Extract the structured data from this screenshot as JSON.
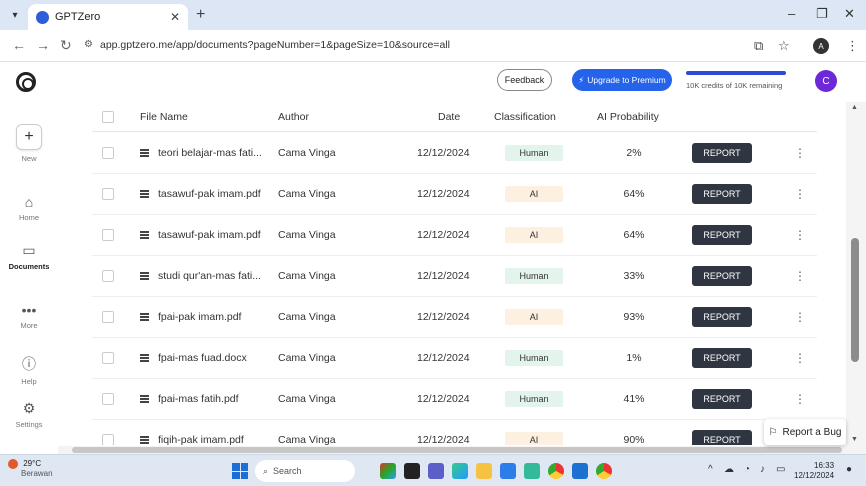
{
  "browser": {
    "tab_title": "GPTZero",
    "url": "app.gptzero.me/app/documents?pageNumber=1&pageSize=10&source=all"
  },
  "header": {
    "feedback_label": "Feedback",
    "upgrade_label": "Upgrade to Premium",
    "credits_text": "10K credits of 10K remaining",
    "credits_fraction": 1.0,
    "avatar_letter": "C"
  },
  "sidebar": {
    "items": [
      {
        "label": "New",
        "icon": "plus-icon"
      },
      {
        "label": "Home",
        "icon": "home-icon"
      },
      {
        "label": "Documents",
        "icon": "folder-icon"
      },
      {
        "label": "More",
        "icon": "more-icon"
      },
      {
        "label": "Help",
        "icon": "help-icon"
      },
      {
        "label": "Settings",
        "icon": "gear-icon"
      }
    ]
  },
  "table": {
    "columns": [
      "File Name",
      "Author",
      "Date",
      "Classification",
      "AI Probability"
    ],
    "report_label": "REPORT",
    "rows": [
      {
        "file": "teori belajar-mas fati...",
        "author": "Cama Vinga",
        "date": "12/12/2024",
        "class": "Human",
        "prob": "2%"
      },
      {
        "file": "tasawuf-pak imam.pdf",
        "author": "Cama Vinga",
        "date": "12/12/2024",
        "class": "AI",
        "prob": "64%"
      },
      {
        "file": "tasawuf-pak imam.pdf",
        "author": "Cama Vinga",
        "date": "12/12/2024",
        "class": "AI",
        "prob": "64%"
      },
      {
        "file": "studi qur'an-mas fati...",
        "author": "Cama Vinga",
        "date": "12/12/2024",
        "class": "Human",
        "prob": "33%"
      },
      {
        "file": "fpai-pak imam.pdf",
        "author": "Cama Vinga",
        "date": "12/12/2024",
        "class": "AI",
        "prob": "93%"
      },
      {
        "file": "fpai-mas fuad.docx",
        "author": "Cama Vinga",
        "date": "12/12/2024",
        "class": "Human",
        "prob": "1%"
      },
      {
        "file": "fpai-mas fatih.pdf",
        "author": "Cama Vinga",
        "date": "12/12/2024",
        "class": "Human",
        "prob": "41%"
      },
      {
        "file": "fiqih-pak imam.pdf",
        "author": "Cama Vinga",
        "date": "12/12/2024",
        "class": "AI",
        "prob": "90%"
      }
    ]
  },
  "report_bug_label": "Report a Bug",
  "taskbar": {
    "temperature": "29°C",
    "weather": "Berawan",
    "search_placeholder": "Search",
    "time": "16:33",
    "date": "12/12/2024"
  },
  "colors": {
    "accent": "#2563eb",
    "avatar": "#6d28d9",
    "report_button": "#2f3642",
    "human_badge": "#e3f4ec",
    "ai_badge": "#fdf0e0"
  }
}
